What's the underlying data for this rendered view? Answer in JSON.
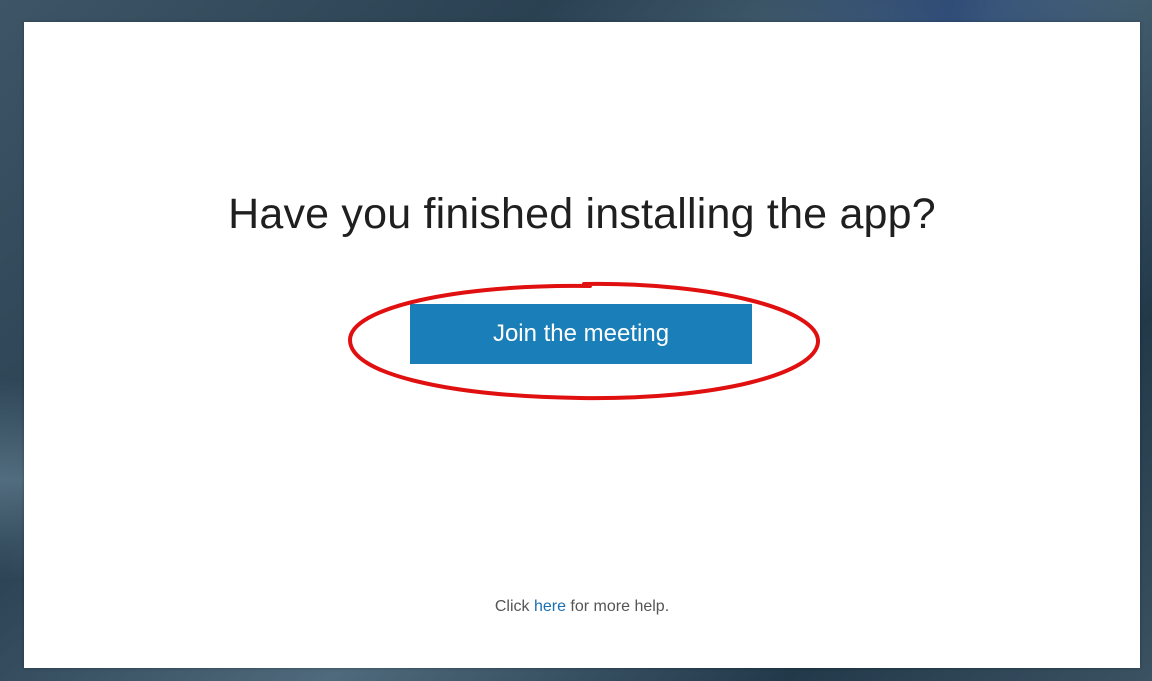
{
  "dialog": {
    "heading": "Have you finished installing the app?",
    "join_button_label": "Join the meeting",
    "help": {
      "prefix": "Click ",
      "link_text": "here",
      "suffix": " for more help."
    }
  },
  "colors": {
    "button_background": "#1a7fb8",
    "link": "#1a6fb0",
    "annotation_ellipse": "#e01010"
  }
}
